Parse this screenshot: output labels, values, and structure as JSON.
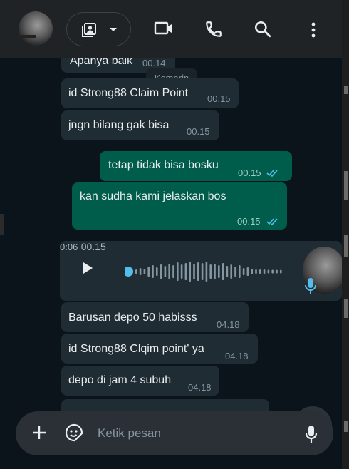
{
  "header": {
    "avatar_alt": "contact-photo",
    "icons": [
      "profile-card-icon",
      "dropdown-icon",
      "video-call-icon",
      "phone-icon",
      "search-icon",
      "menu-icon"
    ]
  },
  "chat": {
    "date_divider": "Kemarin",
    "messages": [
      {
        "dir": "in",
        "text": "Apanya baik",
        "time": "00.14"
      },
      {
        "dir": "in",
        "text": "id Strong88 Claim Point",
        "time": "00.15"
      },
      {
        "dir": "in",
        "text": "jngn bilang gak bisa",
        "time": "00.15"
      },
      {
        "dir": "out",
        "text": "tetap tidak bisa bosku",
        "time": "00.15"
      },
      {
        "dir": "out",
        "text": "kan sudha kami jelaskan bos",
        "time": "00.15"
      },
      {
        "dir": "in",
        "text": "Barusan depo 50 habisss",
        "time": "04.18"
      },
      {
        "dir": "in",
        "text": "id Strong88 Clqim point' ya",
        "time": "04.18"
      },
      {
        "dir": "in",
        "text": "depo di jam 4 subuh",
        "time": "04.18"
      }
    ],
    "voice_note": {
      "duration": "0:06",
      "time": "00.15",
      "progress": 0.0
    }
  },
  "composer": {
    "placeholder": "Ketik pesan"
  },
  "colors": {
    "header_bg": "#1f2326",
    "incoming_bubble": "#202c33",
    "outgoing_bubble": "#005c4b",
    "read_ticks": "#53bdeb",
    "voice_progress": "#53bdeb"
  }
}
